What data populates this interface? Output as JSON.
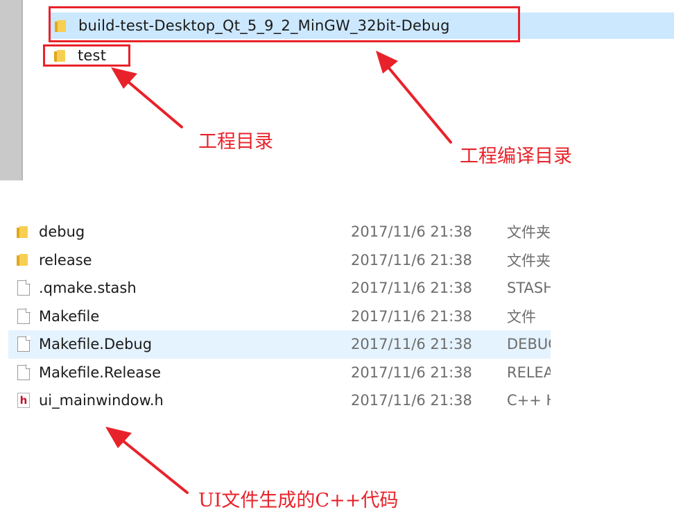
{
  "top_panel": {
    "selected_folder": "build-test-Desktop_Qt_5_9_2_MinGW_32bit-Debug",
    "folder": "test"
  },
  "annotations": {
    "project_dir": "工程目录",
    "build_dir": "工程编译目录",
    "ui_code": "UI文件生成的C++代码"
  },
  "files": [
    {
      "name": "debug",
      "date": "2017/11/6 21:38",
      "type": "文件夹",
      "icon": "folder-icon"
    },
    {
      "name": "release",
      "date": "2017/11/6 21:38",
      "type": "文件夹",
      "icon": "folder-icon"
    },
    {
      "name": ".qmake.stash",
      "date": "2017/11/6 21:38",
      "type": "STASH",
      "icon": "file-icon"
    },
    {
      "name": "Makefile",
      "date": "2017/11/6 21:38",
      "type": "文件",
      "icon": "file-icon"
    },
    {
      "name": "Makefile.Debug",
      "date": "2017/11/6 21:38",
      "type": "DEBUG",
      "icon": "file-icon"
    },
    {
      "name": "Makefile.Release",
      "date": "2017/11/6 21:38",
      "type": "RELEA",
      "icon": "file-icon"
    },
    {
      "name": "ui_mainwindow.h",
      "date": "2017/11/6 21:38",
      "type": "C++ H",
      "icon": "header-file-icon"
    }
  ],
  "colors": {
    "annotation_red": "#e8222a",
    "selection_blue": "#cce8ff",
    "hover_blue": "#e5f3ff",
    "folder_yellow": "#f7cf52"
  }
}
